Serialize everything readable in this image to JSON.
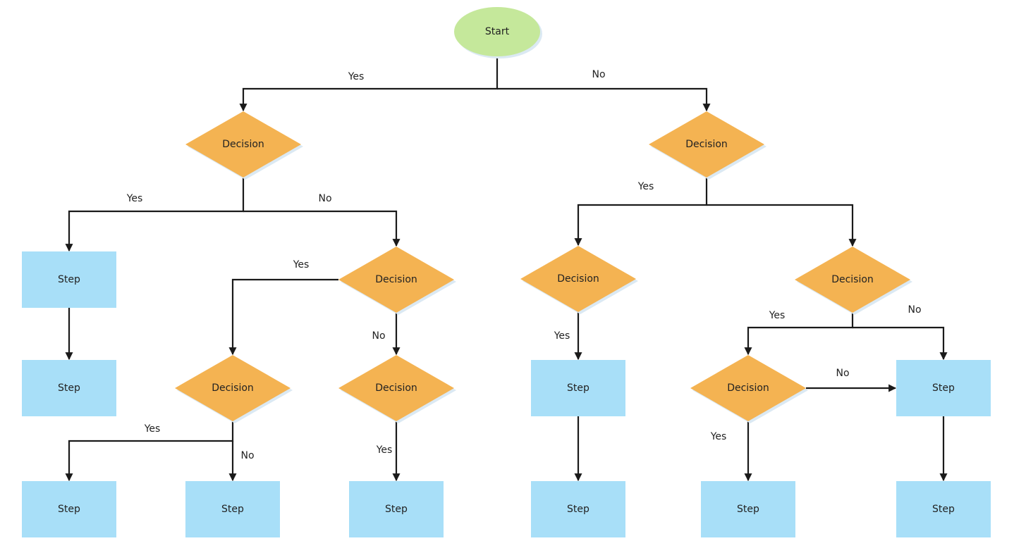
{
  "diagram": {
    "type": "flowchart",
    "colors": {
      "start": "#c5e89b",
      "decision": "#f4b352",
      "step": "#a8dff8",
      "edge": "#1a1a1a",
      "shadow": "#dbe9f3"
    },
    "nodes": [
      {
        "id": "start",
        "shape": "terminal",
        "label": "Start"
      },
      {
        "id": "d1",
        "shape": "decision",
        "label": "Decision"
      },
      {
        "id": "d2",
        "shape": "decision",
        "label": "Decision"
      },
      {
        "id": "s1",
        "shape": "process",
        "label": "Step"
      },
      {
        "id": "d3",
        "shape": "decision",
        "label": "Decision"
      },
      {
        "id": "s2",
        "shape": "process",
        "label": "Step"
      },
      {
        "id": "d4",
        "shape": "decision",
        "label": "Decision"
      },
      {
        "id": "d5",
        "shape": "decision",
        "label": "Decision"
      },
      {
        "id": "s3",
        "shape": "process",
        "label": "Step"
      },
      {
        "id": "s4",
        "shape": "process",
        "label": "Step"
      },
      {
        "id": "s5",
        "shape": "process",
        "label": "Step"
      },
      {
        "id": "d6",
        "shape": "decision",
        "label": "Decision"
      },
      {
        "id": "d7",
        "shape": "decision",
        "label": "Decision"
      },
      {
        "id": "s6",
        "shape": "process",
        "label": "Step"
      },
      {
        "id": "d8",
        "shape": "decision",
        "label": "Decision"
      },
      {
        "id": "s7",
        "shape": "process",
        "label": "Step"
      },
      {
        "id": "s8",
        "shape": "process",
        "label": "Step"
      },
      {
        "id": "s9",
        "shape": "process",
        "label": "Step"
      },
      {
        "id": "s10",
        "shape": "process",
        "label": "Step"
      }
    ],
    "edges": [
      {
        "from": "start",
        "to": "d1",
        "label": "Yes"
      },
      {
        "from": "start",
        "to": "d2",
        "label": "No"
      },
      {
        "from": "d1",
        "to": "s1",
        "label": "Yes"
      },
      {
        "from": "d1",
        "to": "d3",
        "label": "No"
      },
      {
        "from": "s1",
        "to": "s2",
        "label": ""
      },
      {
        "from": "d3",
        "to": "d4",
        "label": "Yes"
      },
      {
        "from": "d3",
        "to": "d5",
        "label": "No"
      },
      {
        "from": "d4",
        "to": "s3",
        "label": "Yes"
      },
      {
        "from": "d4",
        "to": "s4",
        "label": "No"
      },
      {
        "from": "d5",
        "to": "s5",
        "label": "Yes"
      },
      {
        "from": "d2",
        "to": "d6",
        "label": "Yes"
      },
      {
        "from": "d2",
        "to": "d7",
        "label": ""
      },
      {
        "from": "d6",
        "to": "s6",
        "label": "Yes"
      },
      {
        "from": "s6",
        "to": "s8",
        "label": ""
      },
      {
        "from": "d7",
        "to": "d8",
        "label": "Yes"
      },
      {
        "from": "d7",
        "to": "s7",
        "label": "No"
      },
      {
        "from": "d8",
        "to": "s7",
        "label": "No"
      },
      {
        "from": "d8",
        "to": "s9",
        "label": "Yes"
      },
      {
        "from": "s7",
        "to": "s10",
        "label": ""
      }
    ]
  }
}
